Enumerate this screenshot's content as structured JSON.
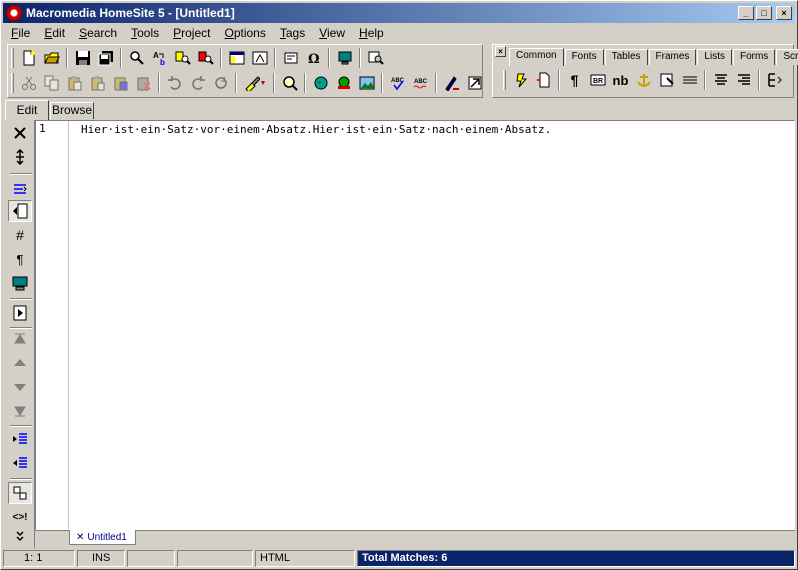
{
  "window": {
    "title": "Macromedia HomeSite 5 - [Untitled1]"
  },
  "menu": [
    {
      "pre": "",
      "u": "F",
      "post": "ile"
    },
    {
      "pre": "",
      "u": "E",
      "post": "dit"
    },
    {
      "pre": "",
      "u": "S",
      "post": "earch"
    },
    {
      "pre": "",
      "u": "T",
      "post": "ools"
    },
    {
      "pre": "",
      "u": "P",
      "post": "roject"
    },
    {
      "pre": "",
      "u": "O",
      "post": "ptions"
    },
    {
      "pre": "",
      "u": "T",
      "post": "ags"
    },
    {
      "pre": "",
      "u": "V",
      "post": "iew"
    },
    {
      "pre": "",
      "u": "H",
      "post": "elp"
    }
  ],
  "tag_tabs": [
    "Common",
    "Fonts",
    "Tables",
    "Frames",
    "Lists",
    "Forms",
    "Script"
  ],
  "tag_tab_active": "Common",
  "view_tabs": {
    "edit": "Edit",
    "browse": "Browse"
  },
  "common_toolbar": {
    "paragraph_glyph": "¶",
    "nbsp_label": "nb"
  },
  "left_toolbar": {
    "hash_glyph": "#",
    "pilcrow_glyph": "¶",
    "comment_glyph": "<>!"
  },
  "editor": {
    "line_number": "1",
    "code": "Hier·ist·ein·Satz·vor·einem·Absatz.Hier·ist·ein·Satz·nach·einem·Absatz."
  },
  "document_tab": {
    "label": "Untitled1"
  },
  "status": {
    "position": "1: 1",
    "mode": "INS",
    "empty1": "",
    "empty2": "",
    "doc_type": "HTML",
    "matches": "Total Matches: 6"
  },
  "colors": {
    "title_start": "#0a246a",
    "title_end": "#a6caf0",
    "matches_bg": "#0a246a",
    "face": "#d4d0c8"
  }
}
